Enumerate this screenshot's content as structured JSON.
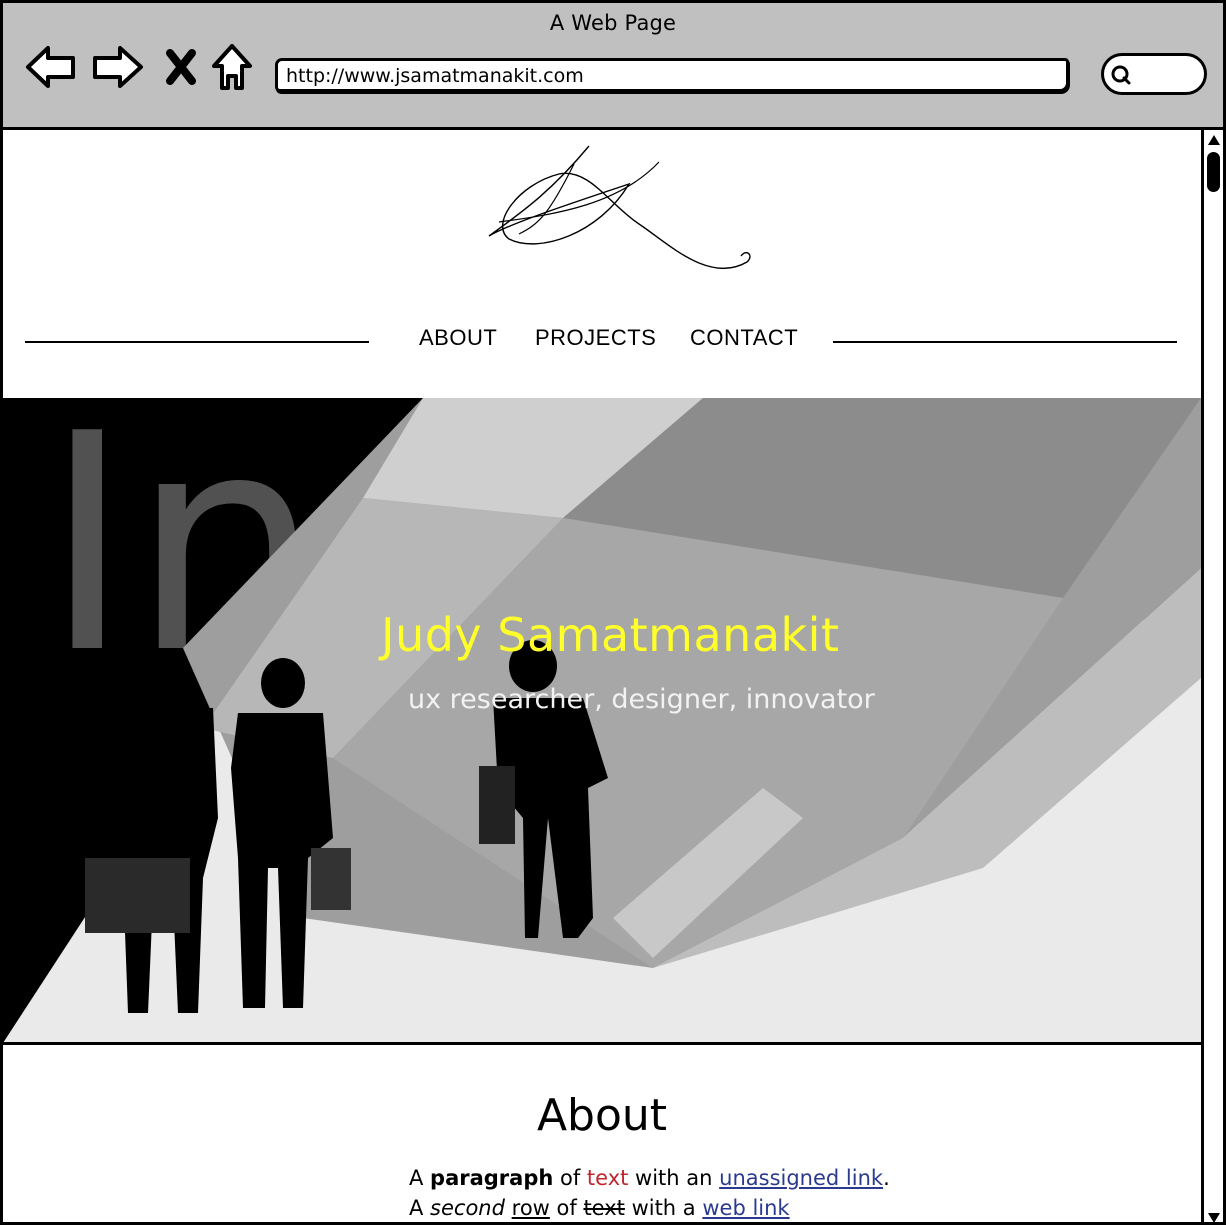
{
  "window": {
    "title": "A Web Page"
  },
  "toolbar": {
    "back_icon": "back-arrow-icon",
    "forward_icon": "forward-arrow-icon",
    "stop_icon": "close-icon",
    "home_icon": "home-icon",
    "url": "http://www.jsamatmanakit.com",
    "search_icon": "search-icon"
  },
  "site": {
    "logo": "signature-logo",
    "nav": [
      "ABOUT",
      "PROJECTS",
      "CONTACT"
    ]
  },
  "hero": {
    "title": "Judy Samatmanakit",
    "subtitle": "ux researcher, designer, innovator",
    "title_color": "#ffff2a",
    "background_image_text": "Innovation"
  },
  "about": {
    "heading": "About",
    "line1": {
      "p1": "A ",
      "bold": "paragraph",
      "p2": " of ",
      "red": "text",
      "p3": " with an ",
      "link": "unassigned link",
      "p4": "."
    },
    "line2": {
      "p1": "A ",
      "italic": "second",
      "p2": " ",
      "underline": "row",
      "p3": " of ",
      "strike": "text",
      "p4": " with a ",
      "link": "web link"
    }
  },
  "colors": {
    "chrome": "#c0c0c0",
    "link": "#2b3a8f",
    "red_text": "#c0262e"
  }
}
